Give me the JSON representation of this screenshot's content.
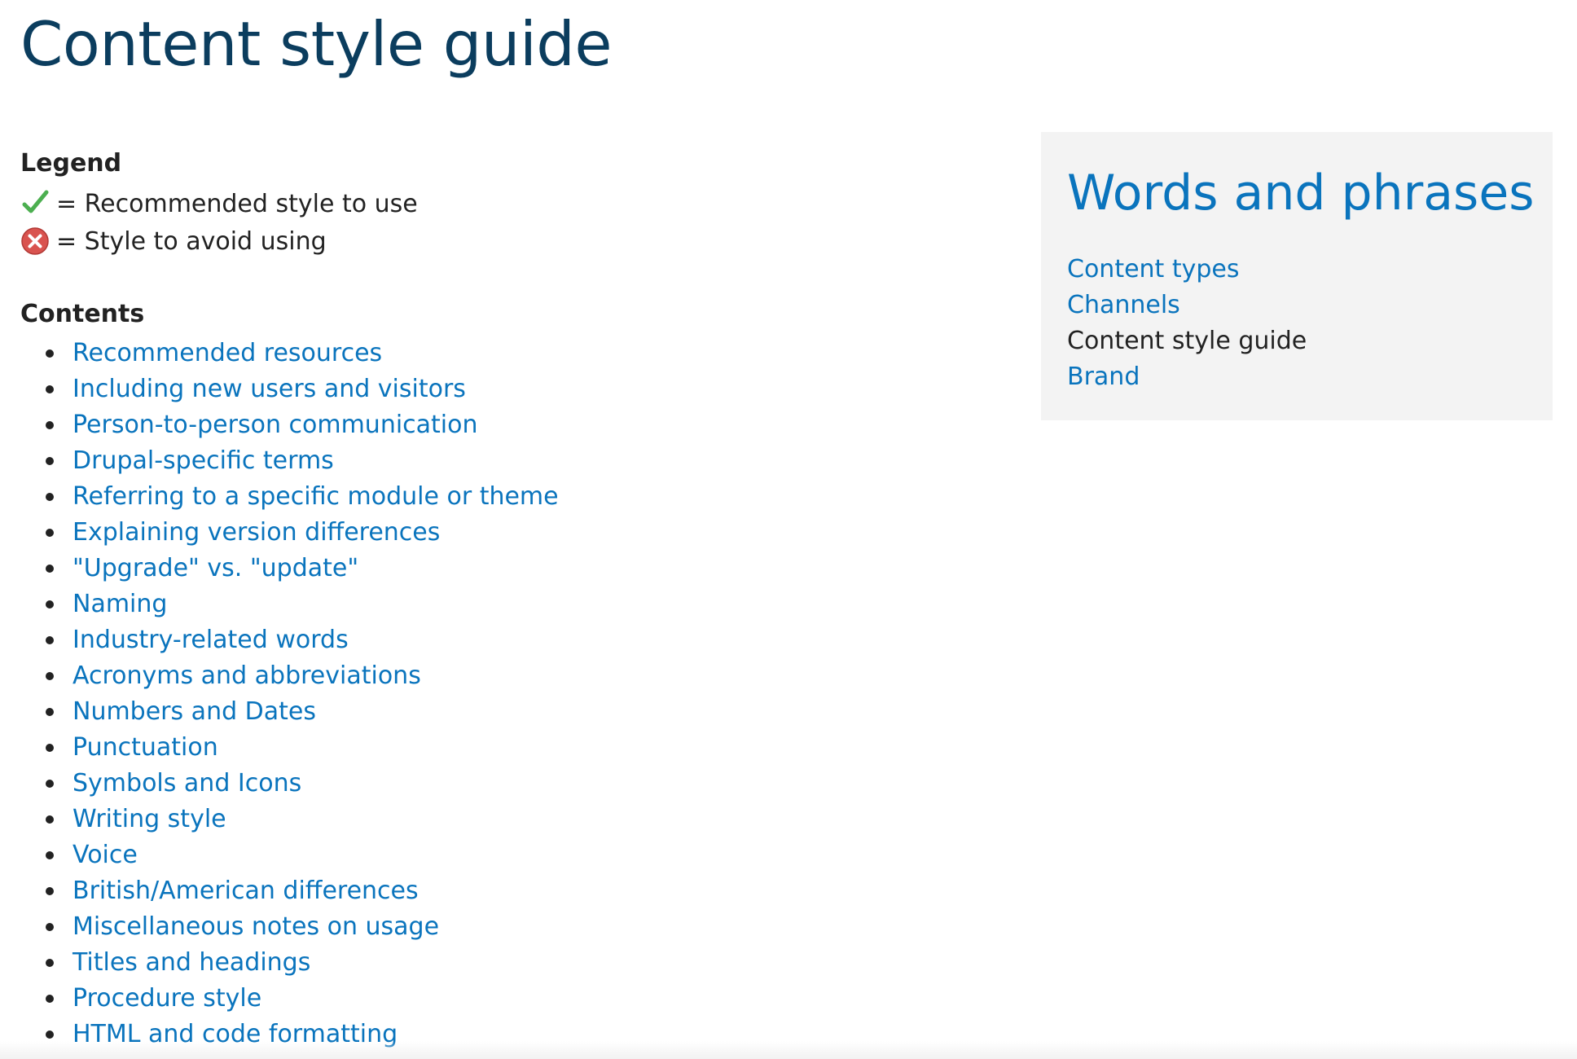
{
  "page": {
    "title": "Content style guide"
  },
  "legend": {
    "heading": "Legend",
    "recommended": {
      "icon": "checkmark-icon",
      "color": "#4caf50",
      "text": "= Recommended style to use"
    },
    "avoid": {
      "icon": "error-x-icon",
      "color": "#d9534f",
      "text": "= Style to avoid using"
    }
  },
  "contents": {
    "heading": "Contents",
    "items": [
      "Recommended resources",
      "Including new users and visitors",
      "Person-to-person communication",
      "Drupal-specific terms",
      "Referring to a specific module or theme",
      "Explaining version differences",
      "\"Upgrade\" vs. \"update\"",
      "Naming",
      "Industry-related words",
      "Acronyms and abbreviations",
      "Numbers and Dates",
      "Punctuation",
      "Symbols and Icons",
      "Writing style",
      "Voice",
      "British/American differences",
      "Miscellaneous notes on usage",
      "Titles and headings",
      "Procedure style",
      "HTML and code formatting"
    ]
  },
  "sidebar": {
    "title": "Words and phrases",
    "links": [
      {
        "label": "Content types",
        "current": false
      },
      {
        "label": "Channels",
        "current": false
      },
      {
        "label": "Content style guide",
        "current": true
      },
      {
        "label": "Brand",
        "current": false
      }
    ]
  },
  "colors": {
    "title": "#0b3d5e",
    "link": "#0a74bd",
    "text": "#222222",
    "sidebar_bg": "#f3f3f3"
  }
}
